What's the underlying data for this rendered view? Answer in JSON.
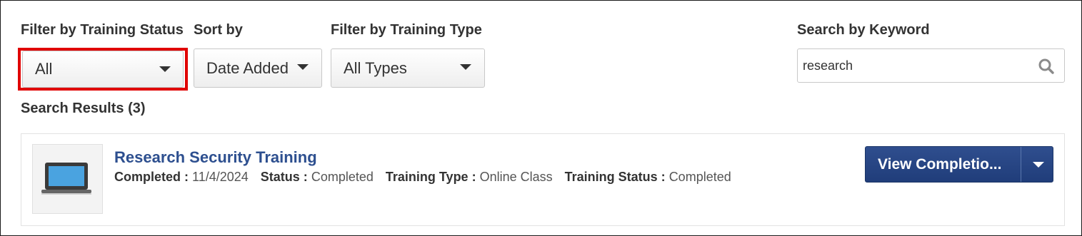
{
  "filters": {
    "training_status": {
      "label": "Filter by Training Status",
      "value": "All"
    },
    "sort": {
      "label": "Sort by",
      "value": "Date Added"
    },
    "training_type": {
      "label": "Filter by Training Type",
      "value": "All Types"
    },
    "keyword": {
      "label": "Search by Keyword",
      "value": "research"
    }
  },
  "results": {
    "heading": "Search Results (3)",
    "items": [
      {
        "title": "Research Security Training",
        "completed_label": "Completed :",
        "completed_value": "11/4/2024",
        "status_label": "Status :",
        "status_value": "Completed",
        "type_label": "Training Type :",
        "type_value": "Online Class",
        "training_status_label": "Training Status :",
        "training_status_value": "Completed",
        "action_label": "View Completio...",
        "icon": "laptop-icon"
      }
    ]
  },
  "colors": {
    "highlight": "#e00000",
    "link": "#2d4f8f",
    "button": "#233f7c"
  }
}
